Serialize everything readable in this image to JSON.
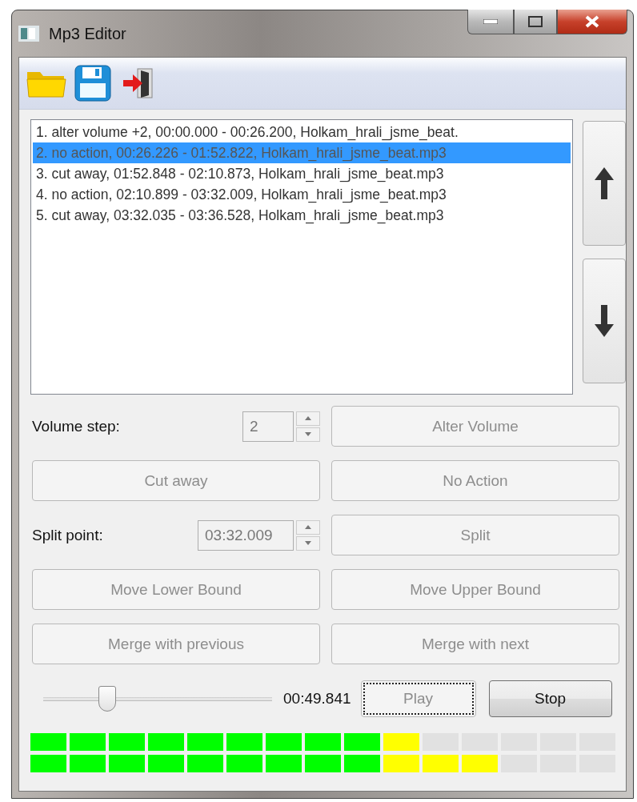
{
  "window": {
    "title": "Mp3 Editor"
  },
  "toolbar": [
    {
      "kind": "open"
    },
    {
      "kind": "save"
    },
    {
      "kind": "exit"
    }
  ],
  "segments": [
    {
      "text": "1. alter volume +2, 00:00.000 - 00:26.200, Holkam_hrali_jsme_beat.",
      "selected": false
    },
    {
      "text": "2. no action, 00:26.226 - 01:52.822, Holkam_hrali_jsme_beat.mp3",
      "selected": true
    },
    {
      "text": "3. cut away, 01:52.848 - 02:10.873, Holkam_hrali_jsme_beat.mp3",
      "selected": false
    },
    {
      "text": "4. no action, 02:10.899 - 03:32.009, Holkam_hrali_jsme_beat.mp3",
      "selected": false
    },
    {
      "text": "5. cut away, 03:32.035 - 03:36.528, Holkam_hrali_jsme_beat.mp3",
      "selected": false
    }
  ],
  "move_buttons": [
    {
      "kind": "up"
    },
    {
      "kind": "down"
    }
  ],
  "controls": [
    {
      "kind": "spin",
      "label": "Volume step:",
      "value": "2"
    },
    {
      "kind": "button",
      "label": "Alter Volume",
      "disabled": true
    },
    {
      "kind": "button",
      "label": "Cut away",
      "disabled": true
    },
    {
      "kind": "button",
      "label": "No Action",
      "disabled": true
    },
    {
      "kind": "spin",
      "label": "Split point:",
      "value": "03:32.009"
    },
    {
      "kind": "button",
      "label": "Split",
      "disabled": true
    },
    {
      "kind": "button",
      "label": "Move Lower Bound",
      "disabled": true
    },
    {
      "kind": "button",
      "label": "Move Upper Bound",
      "disabled": true
    },
    {
      "kind": "button",
      "label": "Merge with previous",
      "disabled": true
    },
    {
      "kind": "button",
      "label": "Merge with next",
      "disabled": true
    }
  ],
  "playback": {
    "position": {
      "level": 0.28
    },
    "time": "00:49.841",
    "buttons": [
      {
        "label": "Play",
        "disabled": true,
        "focused": true
      },
      {
        "label": "Stop",
        "disabled": false,
        "focused": false
      }
    ]
  },
  "meters": [
    {
      "level": 0.667
    },
    {
      "level": 0.8
    }
  ]
}
